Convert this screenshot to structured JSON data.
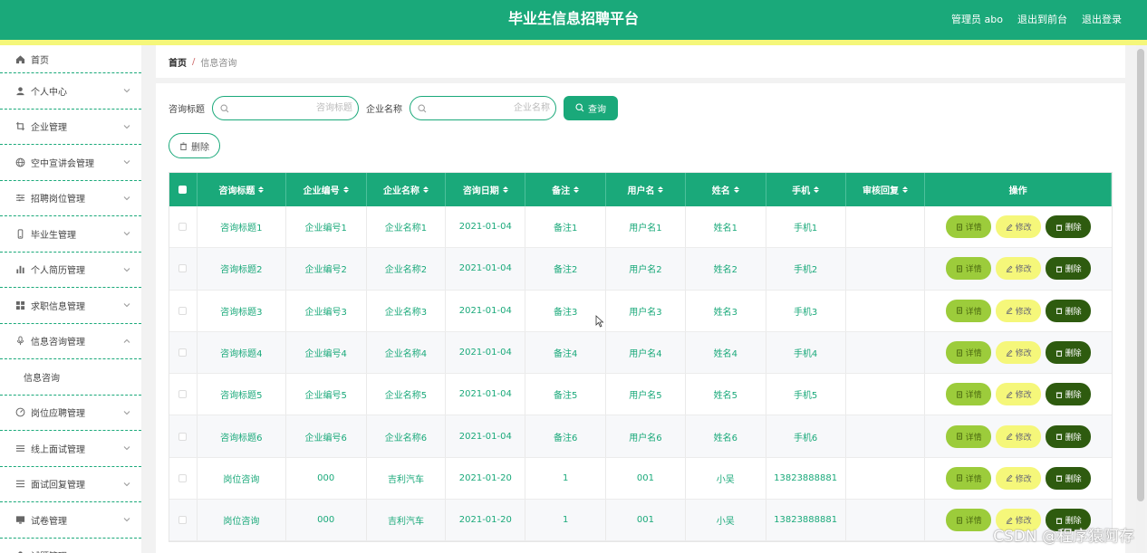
{
  "header": {
    "title": "毕业生信息招聘平台",
    "admin": "管理员 abo",
    "front": "退出到前台",
    "logout": "退出登录"
  },
  "sidebar": {
    "items": [
      {
        "label": "首页",
        "icon": "home-icon",
        "expandable": false
      },
      {
        "label": "个人中心",
        "icon": "user-icon",
        "expandable": true
      },
      {
        "label": "企业管理",
        "icon": "crop-icon",
        "expandable": true
      },
      {
        "label": "空中宣讲会管理",
        "icon": "globe-icon",
        "expandable": true
      },
      {
        "label": "招聘岗位管理",
        "icon": "sliders-icon",
        "expandable": true
      },
      {
        "label": "毕业生管理",
        "icon": "mobile-icon",
        "expandable": true
      },
      {
        "label": "个人简历管理",
        "icon": "bar-chart-icon",
        "expandable": true
      },
      {
        "label": "求职信息管理",
        "icon": "grid-icon",
        "expandable": true
      },
      {
        "label": "信息咨询管理",
        "icon": "mic-icon",
        "expandable": true,
        "expanded": true
      },
      {
        "label": "信息咨询",
        "sub": true
      },
      {
        "label": "岗位应聘管理",
        "icon": "dashboard-icon",
        "expandable": true
      },
      {
        "label": "线上面试管理",
        "icon": "list-icon",
        "expandable": true
      },
      {
        "label": "面试回复管理",
        "icon": "menu-icon",
        "expandable": true
      },
      {
        "label": "试卷管理",
        "icon": "monitor-icon",
        "expandable": true
      },
      {
        "label": "试题管理",
        "icon": "user-icon",
        "expandable": true
      }
    ]
  },
  "breadcrumb": {
    "home": "首页",
    "separator": "/",
    "current": "信息咨询"
  },
  "search": {
    "title_label": "咨询标题",
    "title_placeholder": "咨询标题",
    "company_label": "企业名称",
    "company_placeholder": "企业名称",
    "query_label": "查询"
  },
  "actions": {
    "delete_label": "删除"
  },
  "table": {
    "headers": [
      "咨询标题",
      "企业编号",
      "企业名称",
      "咨询日期",
      "备注",
      "用户名",
      "姓名",
      "手机",
      "审核回复",
      "操作"
    ],
    "ops": {
      "detail": "详情",
      "edit": "修改",
      "delete": "删除"
    },
    "rows": [
      [
        "咨询标题1",
        "企业编号1",
        "企业名称1",
        "2021-01-04",
        "备注1",
        "用户名1",
        "姓名1",
        "手机1",
        ""
      ],
      [
        "咨询标题2",
        "企业编号2",
        "企业名称2",
        "2021-01-04",
        "备注2",
        "用户名2",
        "姓名2",
        "手机2",
        ""
      ],
      [
        "咨询标题3",
        "企业编号3",
        "企业名称3",
        "2021-01-04",
        "备注3",
        "用户名3",
        "姓名3",
        "手机3",
        ""
      ],
      [
        "咨询标题4",
        "企业编号4",
        "企业名称4",
        "2021-01-04",
        "备注4",
        "用户名4",
        "姓名4",
        "手机4",
        ""
      ],
      [
        "咨询标题5",
        "企业编号5",
        "企业名称5",
        "2021-01-04",
        "备注5",
        "用户名5",
        "姓名5",
        "手机5",
        ""
      ],
      [
        "咨询标题6",
        "企业编号6",
        "企业名称6",
        "2021-01-04",
        "备注6",
        "用户名6",
        "姓名6",
        "手机6",
        ""
      ],
      [
        "岗位咨询",
        "000",
        "吉利汽车",
        "2021-01-20",
        "1",
        "001",
        "小吴",
        "13823888881",
        ""
      ],
      [
        "岗位咨询",
        "000",
        "吉利汽车",
        "2021-01-20",
        "1",
        "001",
        "小吴",
        "13823888881",
        ""
      ]
    ]
  },
  "watermark": "CSDN @程序猿阿存",
  "colors": {
    "primary": "#1aa97a",
    "strip": "#f5f77a",
    "detail": "#9ccc3b",
    "edit": "#f5f77a",
    "delete": "#2e5b0f"
  }
}
